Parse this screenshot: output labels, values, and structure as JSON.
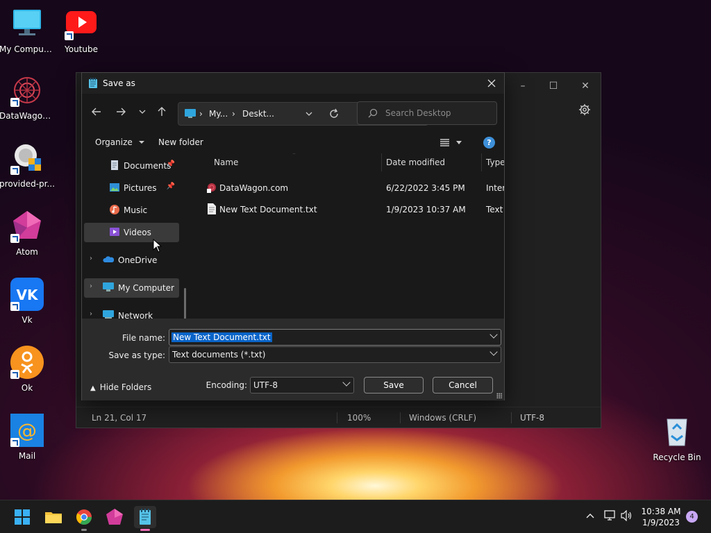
{
  "desktop": {
    "icons": [
      {
        "label": "My Computer",
        "icon": "monitor-icon"
      },
      {
        "label": "Youtube",
        "icon": "youtube-icon"
      },
      {
        "label": "DataWagon...",
        "icon": "datawagon-icon"
      },
      {
        "label": "provided-pr...",
        "icon": "setup-icon"
      },
      {
        "label": "Atom",
        "icon": "atom-icon"
      },
      {
        "label": "Vk",
        "icon": "vk-icon"
      },
      {
        "label": "Ok",
        "icon": "ok-icon"
      },
      {
        "label": "Mail",
        "icon": "mail-icon"
      },
      {
        "label": "Recycle Bin",
        "icon": "recycle-bin-icon"
      }
    ]
  },
  "notepad": {
    "status": {
      "position": "Ln 21, Col 17",
      "zoom": "100%",
      "line_ending": "Windows (CRLF)",
      "encoding": "UTF-8"
    }
  },
  "dialog": {
    "title": "Save as",
    "address": {
      "seg1": "My...",
      "seg2": "Deskt..."
    },
    "search_placeholder": "Search Desktop",
    "toolbar": {
      "organize": "Organize",
      "new_folder": "New folder",
      "help": "?"
    },
    "nav_items": [
      {
        "label": "Documents",
        "icon": "documents-icon",
        "pinned": true
      },
      {
        "label": "Pictures",
        "icon": "pictures-icon",
        "pinned": true
      },
      {
        "label": "Music",
        "icon": "music-icon",
        "pinned": false
      },
      {
        "label": "Videos",
        "icon": "videos-icon",
        "pinned": false,
        "selected": true
      },
      {
        "label": "OneDrive",
        "icon": "onedrive-icon",
        "expandable": true
      },
      {
        "label": "My Computer",
        "icon": "computer-icon",
        "expandable": true,
        "selected": true
      },
      {
        "label": "Network",
        "icon": "network-icon",
        "expandable": true
      }
    ],
    "columns": {
      "name": "Name",
      "date": "Date modified",
      "type": "Type"
    },
    "files": [
      {
        "name": "DataWagon.com",
        "date": "6/22/2022 3:45 PM",
        "type": "Intern"
      },
      {
        "name": "New Text Document.txt",
        "date": "1/9/2023 10:37 AM",
        "type": "Text D"
      }
    ],
    "file_name_label": "File name:",
    "file_name_value": "New Text Document.txt",
    "save_type_label": "Save as type:",
    "save_type_value": "Text documents (*.txt)",
    "hide_folders": "Hide Folders",
    "encoding_label": "Encoding:",
    "encoding_value": "UTF-8",
    "save_button": "Save",
    "cancel_button": "Cancel"
  },
  "taskbar": {
    "time": "10:38 AM",
    "date": "1/9/2023",
    "notifications": "4"
  }
}
